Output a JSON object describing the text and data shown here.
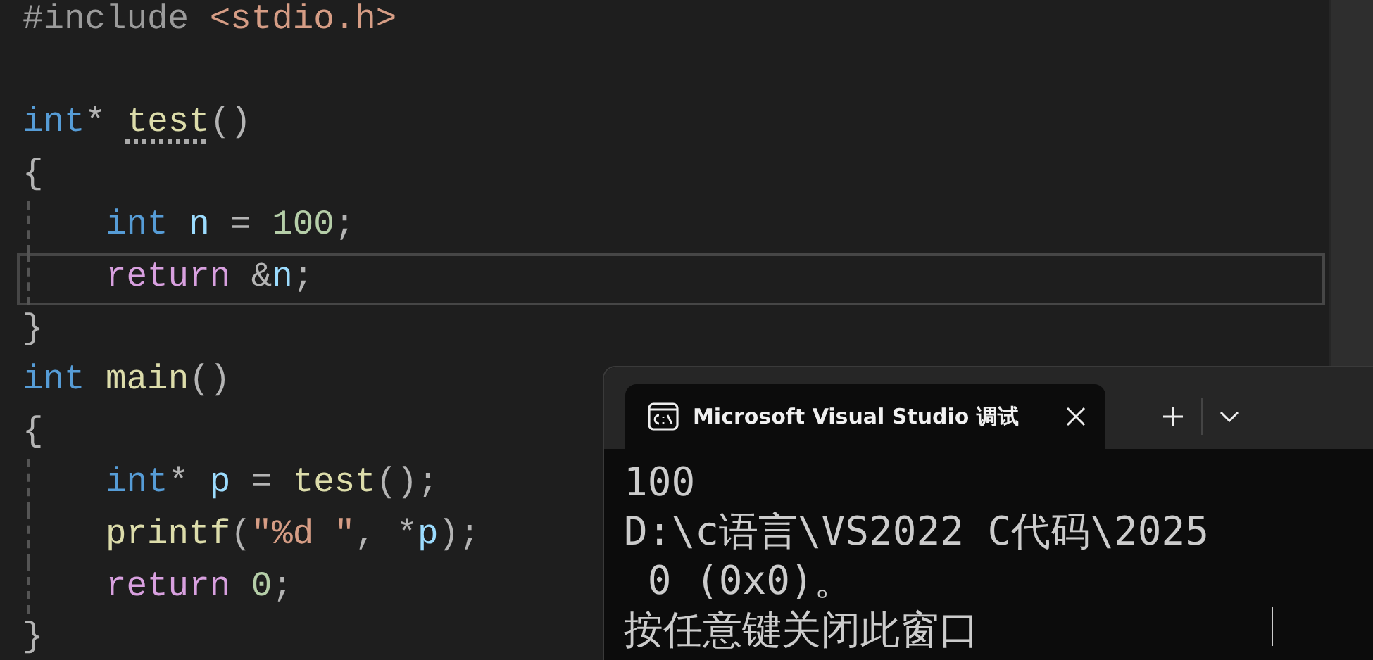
{
  "editor": {
    "lines": [
      {
        "kind": "code",
        "indent_guide": false,
        "current": false,
        "tokens": [
          {
            "text": "#include",
            "kind": "preprocessor"
          },
          {
            "text": " <stdio.h>",
            "kind": "string"
          }
        ]
      },
      {
        "kind": "blank"
      },
      {
        "kind": "code",
        "indent_guide": false,
        "current": false,
        "tokens": [
          {
            "text": "int",
            "kind": "keyword"
          },
          {
            "text": "* ",
            "kind": "punct"
          },
          {
            "text": "test",
            "kind": "function",
            "squiggle": true
          },
          {
            "text": "()",
            "kind": "punct"
          }
        ]
      },
      {
        "kind": "code",
        "indent_guide": false,
        "current": false,
        "tokens": [
          {
            "text": "{",
            "kind": "punct"
          }
        ]
      },
      {
        "kind": "code",
        "indent_guide": true,
        "current": false,
        "tokens": [
          {
            "text": "    int",
            "kind": "keyword"
          },
          {
            "text": " n",
            "kind": "variable"
          },
          {
            "text": " = ",
            "kind": "punct"
          },
          {
            "text": "100",
            "kind": "number"
          },
          {
            "text": ";",
            "kind": "punct"
          }
        ]
      },
      {
        "kind": "code",
        "indent_guide": true,
        "current": true,
        "tokens": [
          {
            "text": "    return",
            "kind": "control"
          },
          {
            "text": " &",
            "kind": "punct"
          },
          {
            "text": "n",
            "kind": "variable"
          },
          {
            "text": ";",
            "kind": "punct"
          }
        ]
      },
      {
        "kind": "code",
        "indent_guide": false,
        "current": false,
        "tokens": [
          {
            "text": "}",
            "kind": "punct"
          }
        ]
      },
      {
        "kind": "code",
        "indent_guide": false,
        "current": false,
        "tokens": [
          {
            "text": "int",
            "kind": "keyword"
          },
          {
            "text": " main",
            "kind": "function"
          },
          {
            "text": "()",
            "kind": "punct"
          }
        ]
      },
      {
        "kind": "code",
        "indent_guide": false,
        "current": false,
        "tokens": [
          {
            "text": "{",
            "kind": "punct"
          }
        ]
      },
      {
        "kind": "code",
        "indent_guide": true,
        "current": false,
        "tokens": [
          {
            "text": "    int",
            "kind": "keyword"
          },
          {
            "text": "* ",
            "kind": "punct"
          },
          {
            "text": "p",
            "kind": "variable"
          },
          {
            "text": " = ",
            "kind": "punct"
          },
          {
            "text": "test",
            "kind": "function"
          },
          {
            "text": "();",
            "kind": "punct"
          }
        ]
      },
      {
        "kind": "code",
        "indent_guide": true,
        "current": false,
        "tokens": [
          {
            "text": "    printf",
            "kind": "function"
          },
          {
            "text": "(",
            "kind": "punct"
          },
          {
            "text": "\"%d \"",
            "kind": "string"
          },
          {
            "text": ", *",
            "kind": "punct"
          },
          {
            "text": "p",
            "kind": "variable"
          },
          {
            "text": ");",
            "kind": "punct"
          }
        ]
      },
      {
        "kind": "code",
        "indent_guide": true,
        "current": false,
        "tokens": [
          {
            "text": "    return",
            "kind": "control"
          },
          {
            "text": " 0",
            "kind": "number"
          },
          {
            "text": ";",
            "kind": "punct"
          }
        ]
      },
      {
        "kind": "code",
        "indent_guide": false,
        "current": false,
        "tokens": [
          {
            "text": "}",
            "kind": "punct"
          }
        ]
      }
    ]
  },
  "terminal": {
    "tab": {
      "title": "Microsoft Visual Studio 调试"
    },
    "lines": [
      "100",
      "D:\\c语言\\VS2022 C代码\\2025",
      " 0 (0x0)。",
      "按任意键关闭此窗口"
    ]
  }
}
